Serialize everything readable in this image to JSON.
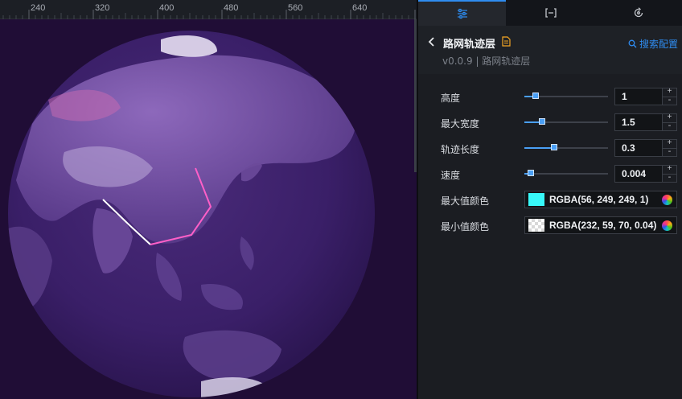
{
  "ruler": {
    "ticks": [
      "240",
      "320",
      "400",
      "480",
      "560",
      "640"
    ]
  },
  "tabs": [
    {
      "name": "style-settings",
      "icon": "sliders-icon",
      "active": true
    },
    {
      "name": "data-settings",
      "icon": "bracket-icon",
      "active": false
    },
    {
      "name": "interaction-settings",
      "icon": "refresh-icon",
      "active": false
    }
  ],
  "header": {
    "title": "路网轨迹层",
    "version": "v0.0.9 | 路网轨迹层",
    "search_config": "搜索配置"
  },
  "settings": {
    "height": {
      "label": "高度",
      "value": "1",
      "level": 0.06
    },
    "max_width": {
      "label": "最大宽度",
      "value": "1.5",
      "level": 0.14
    },
    "trail_length": {
      "label": "轨迹长度",
      "value": "0.3",
      "level": 0.3
    },
    "speed": {
      "label": "速度",
      "value": "0.004",
      "level": 0.0
    },
    "max_color": {
      "label": "最大值颜色",
      "value": "RGBA(56, 249, 249, 1)",
      "swatch": "#38f9f9"
    },
    "min_color": {
      "label": "最小值颜色",
      "value": "RGBA(232, 59, 70, 0.04)",
      "swatch": "transparent"
    }
  },
  "stepper": {
    "plus": "+",
    "minus": "-"
  },
  "colors": {
    "accent": "#2f8cf0",
    "globe_base": "#3a1f68",
    "trail_pink": "#ff5fc8",
    "trail_white": "#ffffff"
  }
}
